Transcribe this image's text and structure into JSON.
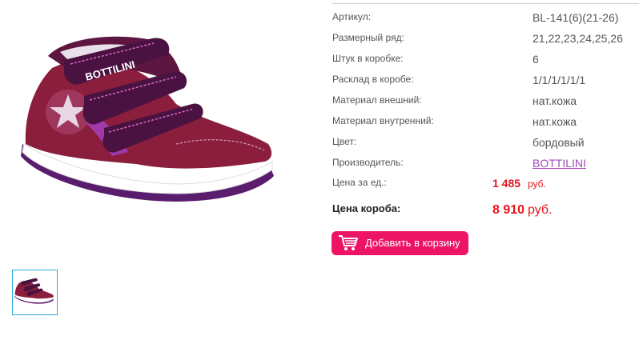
{
  "product": {
    "brand_logo_text": "BOTTILINI",
    "specs": [
      {
        "label": "Артикул:",
        "value": "BL-141(6)(21-26)"
      },
      {
        "label": "Размерный ряд:",
        "value": "21,22,23,24,25,26"
      },
      {
        "label": "Штук в коробке:",
        "value": "6"
      },
      {
        "label": "Расклад в коробе:",
        "value": "1/1/1/1/1/1"
      },
      {
        "label": "Материал внешний:",
        "value": "нат.кожа"
      },
      {
        "label": "Материал внутренний:",
        "value": "нат.кожа"
      },
      {
        "label": "Цвет:",
        "value": "бордовый"
      },
      {
        "label": "Производитель:",
        "value": "BOTTILINI"
      }
    ],
    "price_unit": {
      "label": "Цена за ед.:",
      "value": "1 485",
      "currency": "руб."
    },
    "price_box": {
      "label": "Цена короба:",
      "value": "8 910",
      "currency": "руб."
    },
    "add_to_cart_label": "Добавить в корзину"
  },
  "colors": {
    "accent_pink": "#ed1466",
    "price_red": "#e8141c",
    "link_purple": "#a24ab8",
    "thumb_border": "#2aa9d6"
  }
}
